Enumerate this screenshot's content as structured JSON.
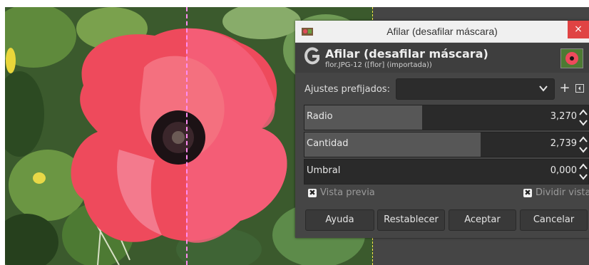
{
  "dialog": {
    "window_title": "Afilar (desafilar máscara)",
    "close_glyph": "×",
    "header_title": "Afilar (desafilar máscara)",
    "header_subtitle": "flor.JPG-12 ([flor] (importada))",
    "presets_label": "Ajustes prefijados:",
    "presets_value": "",
    "add_preset_glyph": "+",
    "sliders": [
      {
        "label": "Radio",
        "value": "3,270",
        "fill_fraction": 0.415
      },
      {
        "label": "Cantidad",
        "value": "2,739",
        "fill_fraction": 0.62
      },
      {
        "label": "Umbral",
        "value": "0,000",
        "fill_fraction": 0.0
      }
    ],
    "preview_label": "Vista previa",
    "preview_checked": true,
    "split_label": "Dividir vista",
    "split_checked": true,
    "check_glyph": "✖",
    "buttons": {
      "help": "Ayuda",
      "reset": "Restablecer",
      "ok": "Aceptar",
      "cancel": "Cancelar"
    }
  },
  "colors": {
    "dialog_bg": "#454545",
    "close_button": "#e04343",
    "split_line": "#ff8cf2",
    "canvas_boundary": "#ffe94a"
  },
  "icons": [
    "gimp-app-icon",
    "close-icon",
    "gimp-logo-icon",
    "image-thumbnail",
    "chevron-down-icon",
    "add-icon",
    "menu-icon",
    "spin-arrows-icon"
  ]
}
